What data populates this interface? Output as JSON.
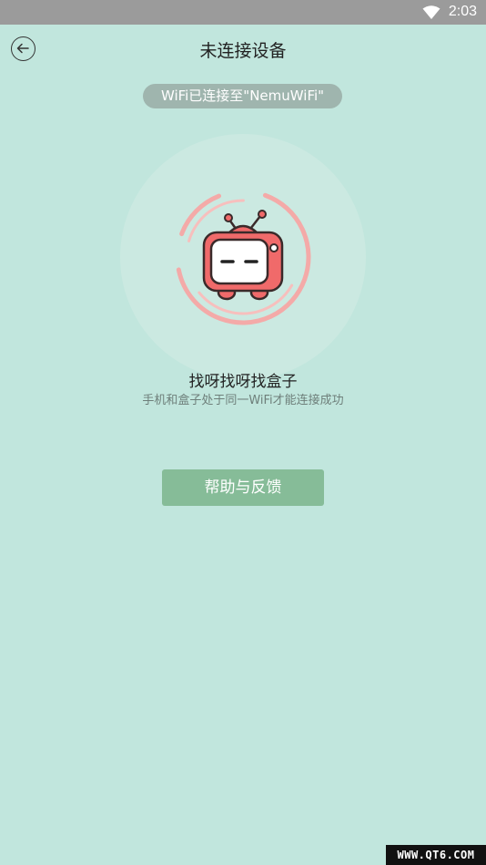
{
  "status_bar": {
    "wifi_icon": "wifi-icon",
    "time": "2:03"
  },
  "header": {
    "back_icon": "back-arrow-icon",
    "title": "未连接设备"
  },
  "wifi_status": {
    "text": "WiFi已连接至\"NemuWiFi\""
  },
  "illustration": {
    "icon": "tv-robot-icon",
    "accent_color": "#f06a6a"
  },
  "search": {
    "title": "找呀找呀找盒子",
    "hint": "手机和盒子处于同一WiFi才能连接成功"
  },
  "actions": {
    "help_label": "帮助与反馈"
  },
  "watermark": {
    "text": "WWW.QT6.COM"
  },
  "colors": {
    "background": "#c1e6dd",
    "status_bar": "#9b9b9b",
    "badge": "#9fb5ae",
    "button": "#86bc98"
  }
}
